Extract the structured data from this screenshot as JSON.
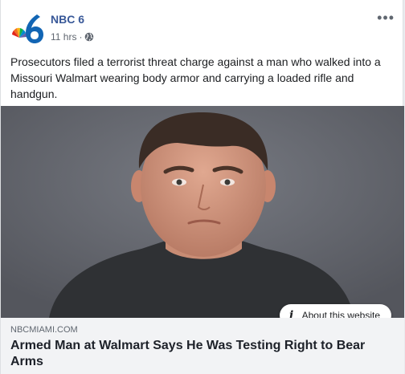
{
  "post": {
    "page_name": "NBC 6",
    "time": "11 hrs",
    "separator": "·",
    "more_icon": "•••",
    "text": "Prosecutors filed a terrorist threat charge against a man who walked into a Missouri Walmart wearing body armor and carrying a loaded rifle and handgun."
  },
  "about": {
    "icon": "i",
    "label": "About this website"
  },
  "link": {
    "domain": "NBCMIAMI.COM",
    "headline": "Armed Man at Walmart Says He Was Testing Right to Bear Arms"
  },
  "colors": {
    "page_name": "#385898",
    "nbc_blue": "#1265b4"
  }
}
